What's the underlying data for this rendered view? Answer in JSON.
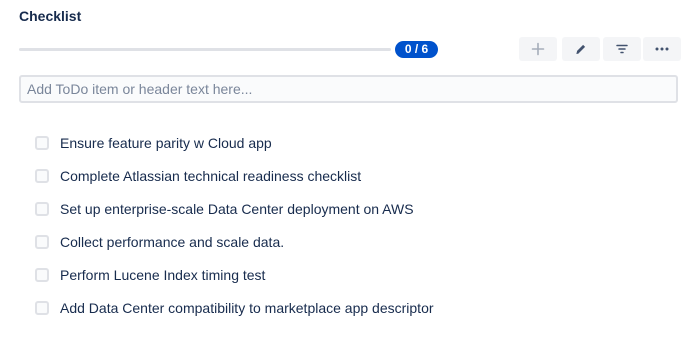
{
  "checklist": {
    "title": "Checklist",
    "progress": {
      "label": "0 / 6",
      "completed": 0,
      "total": 6,
      "fraction": 0
    },
    "input_placeholder": "Add ToDo item or header text here...",
    "input_value": "",
    "toolbar": {
      "add_icon": "plus-icon",
      "edit_icon": "pencil-icon",
      "filter_icon": "filter-icon",
      "more_icon": "more-horizontal-icon"
    },
    "items": [
      {
        "label": "Ensure feature parity w Cloud app",
        "checked": false
      },
      {
        "label": "Complete Atlassian technical readiness checklist",
        "checked": false
      },
      {
        "label": "Set up enterprise-scale Data Center deployment on AWS",
        "checked": false
      },
      {
        "label": "Collect performance and scale data.",
        "checked": false
      },
      {
        "label": "Perform Lucene Index timing test",
        "checked": false
      },
      {
        "label": "Add Data Center compatibility to marketplace app descriptor",
        "checked": false
      }
    ],
    "colors": {
      "badge": "#0052cc",
      "progress_track": "#dfe1e6",
      "text": "#172b4d",
      "placeholder": "#7a869a"
    }
  }
}
